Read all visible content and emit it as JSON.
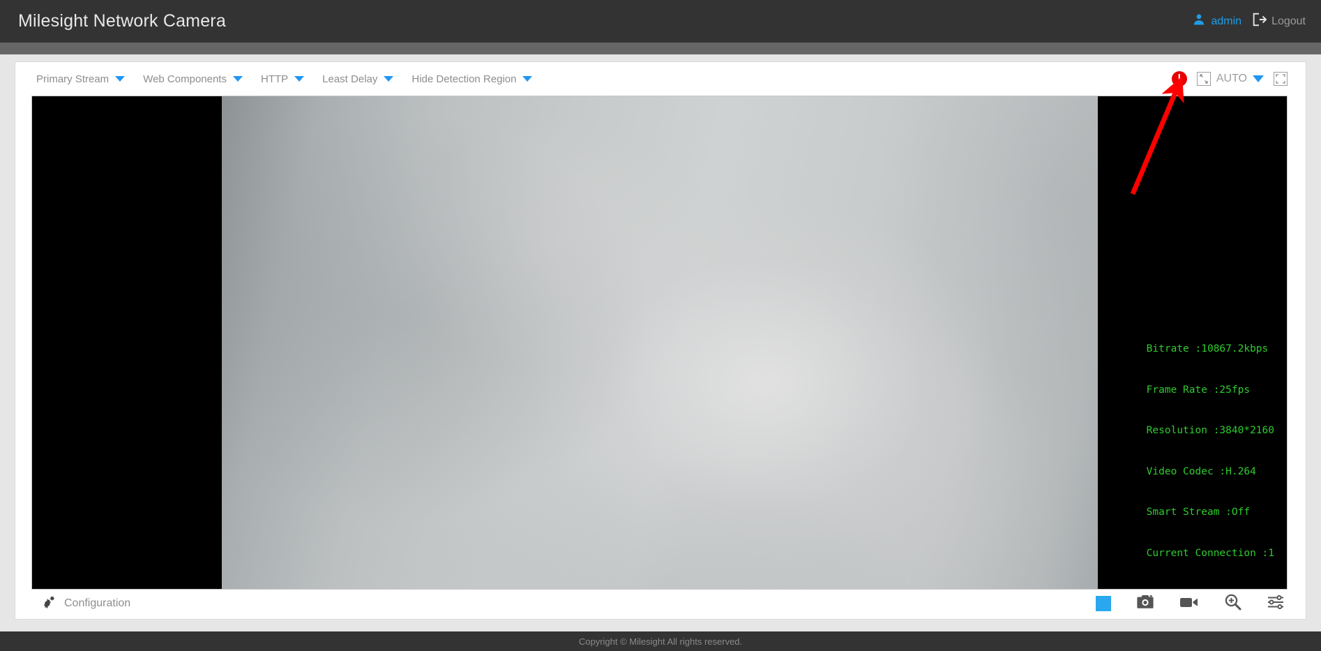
{
  "header": {
    "title": "Milesight Network Camera",
    "user_icon": "user-icon",
    "user_name": "admin",
    "logout_icon": "logout-icon",
    "logout_label": "Logout"
  },
  "stream_toolbar": {
    "options": [
      {
        "label": "Primary Stream",
        "icon": "chevron-down-icon"
      },
      {
        "label": "Web Components",
        "icon": "chevron-down-icon"
      },
      {
        "label": "HTTP",
        "icon": "chevron-down-icon"
      },
      {
        "label": "Least Delay",
        "icon": "chevron-down-icon"
      },
      {
        "label": "Hide Detection Region",
        "icon": "chevron-down-icon"
      }
    ],
    "alert_icon": "alert-exclamation-icon",
    "alert_glyph": "!",
    "shrink_icon": "shrink-icon",
    "auto_label": "AUTO",
    "auto_caret_icon": "chevron-down-icon",
    "fullscreen_icon": "fullscreen-icon"
  },
  "video": {
    "osd": {
      "bitrate": "Bitrate :10867.2kbps",
      "frame_rate": "Frame Rate :25fps",
      "resolution": "Resolution :3840*2160",
      "video_codec": "Video Codec :H.264",
      "smart_stream": "Smart Stream :Off",
      "current_connection": "Current Connection :1"
    },
    "osd_color": "#2ecc2e"
  },
  "bottom_bar": {
    "config_icon": "gear-icon",
    "config_label": "Configuration",
    "tools": [
      {
        "name": "stop-button",
        "icon": "stop-square-icon"
      },
      {
        "name": "snapshot-button",
        "icon": "camera-icon"
      },
      {
        "name": "record-button",
        "icon": "video-camera-icon"
      },
      {
        "name": "digital-zoom-button",
        "icon": "zoom-in-icon"
      },
      {
        "name": "image-settings-button",
        "icon": "sliders-icon"
      }
    ]
  },
  "footer": {
    "copyright": "Copyright © Milesight All rights reserved."
  },
  "annotation": {
    "arrow_color": "#ff0000",
    "arrow_from": "1624,275",
    "arrow_to": "1690,122"
  },
  "colors": {
    "header_bg": "#333333",
    "subheader_bg": "#666666",
    "page_bg": "#e6e6e6",
    "panel_bg": "#ffffff",
    "accent_blue": "#2196f3",
    "link_blue": "#1e9fe8",
    "alert_red": "#e60000",
    "osd_green": "#2ecc2e",
    "muted_text": "#8d8d8d"
  }
}
